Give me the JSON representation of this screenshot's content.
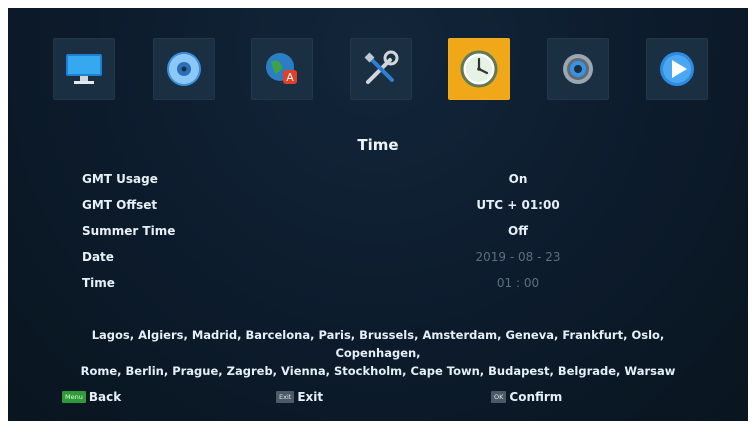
{
  "menu_icons": [
    {
      "name": "monitor-icon",
      "active": false
    },
    {
      "name": "disc-icon",
      "active": false
    },
    {
      "name": "language-globe-icon",
      "active": false
    },
    {
      "name": "tools-icon",
      "active": false
    },
    {
      "name": "clock-icon",
      "active": true
    },
    {
      "name": "gear-icon",
      "active": false
    },
    {
      "name": "play-icon",
      "active": false
    }
  ],
  "title": "Time",
  "settings": [
    {
      "label": "GMT Usage",
      "value": "On",
      "enabled": true
    },
    {
      "label": "GMT Offset",
      "value": "UTC + 01:00",
      "enabled": true
    },
    {
      "label": "Summer Time",
      "value": "Off",
      "enabled": true
    },
    {
      "label": "Date",
      "value": "2019 - 08 - 23",
      "enabled": false
    },
    {
      "label": "Time",
      "value": "01 : 00",
      "enabled": false
    }
  ],
  "cities_line1": "Lagos, Algiers, Madrid, Barcelona, Paris, Brussels, Amsterdam, Geneva, Frankfurt, Oslo, Copenhagen,",
  "cities_line2": "Rome, Berlin, Prague, Zagreb, Vienna, Stockholm, Cape Town, Budapest, Belgrade, Warsaw",
  "footer": {
    "back": {
      "key": "Menu",
      "label": "Back"
    },
    "exit": {
      "key": "Exit",
      "label": "Exit"
    },
    "confirm": {
      "key": "OK",
      "label": "Confirm"
    }
  },
  "colors": {
    "active_tile": "#f0a818",
    "background": "#0b1a2a",
    "key_green": "#2e9a3a"
  }
}
